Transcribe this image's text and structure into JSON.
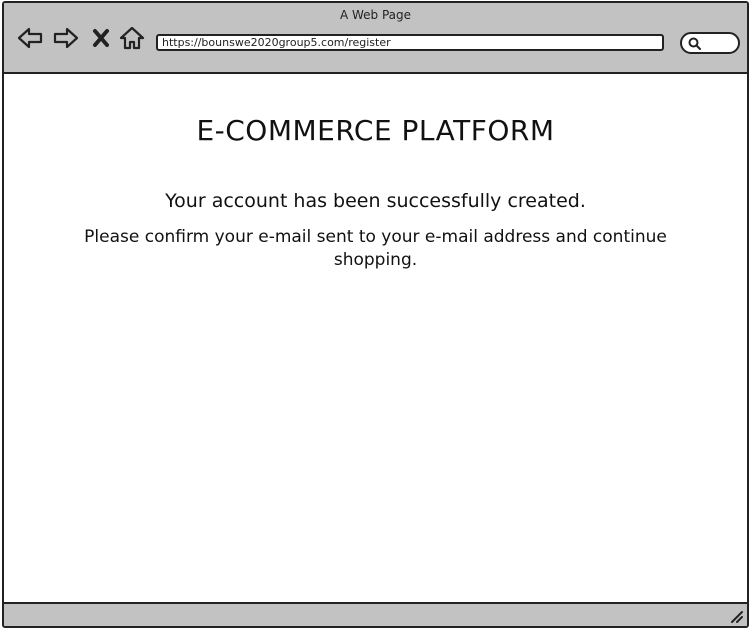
{
  "window": {
    "title": "A Web Page"
  },
  "toolbar": {
    "back_icon": "back-arrow-icon",
    "forward_icon": "forward-arrow-icon",
    "stop_icon": "close-icon",
    "home_icon": "home-icon",
    "url": "https://bounswe2020group5.com/register",
    "search_icon": "search-icon"
  },
  "main": {
    "title": "E-COMMERCE PLATFORM",
    "success_message": "Your account has been successfully created.",
    "confirm_message": "Please confirm your e-mail sent to your e-mail address and continue shopping."
  },
  "colors": {
    "chrome": "#c2c2c2",
    "border": "#222222",
    "background": "#ffffff"
  }
}
